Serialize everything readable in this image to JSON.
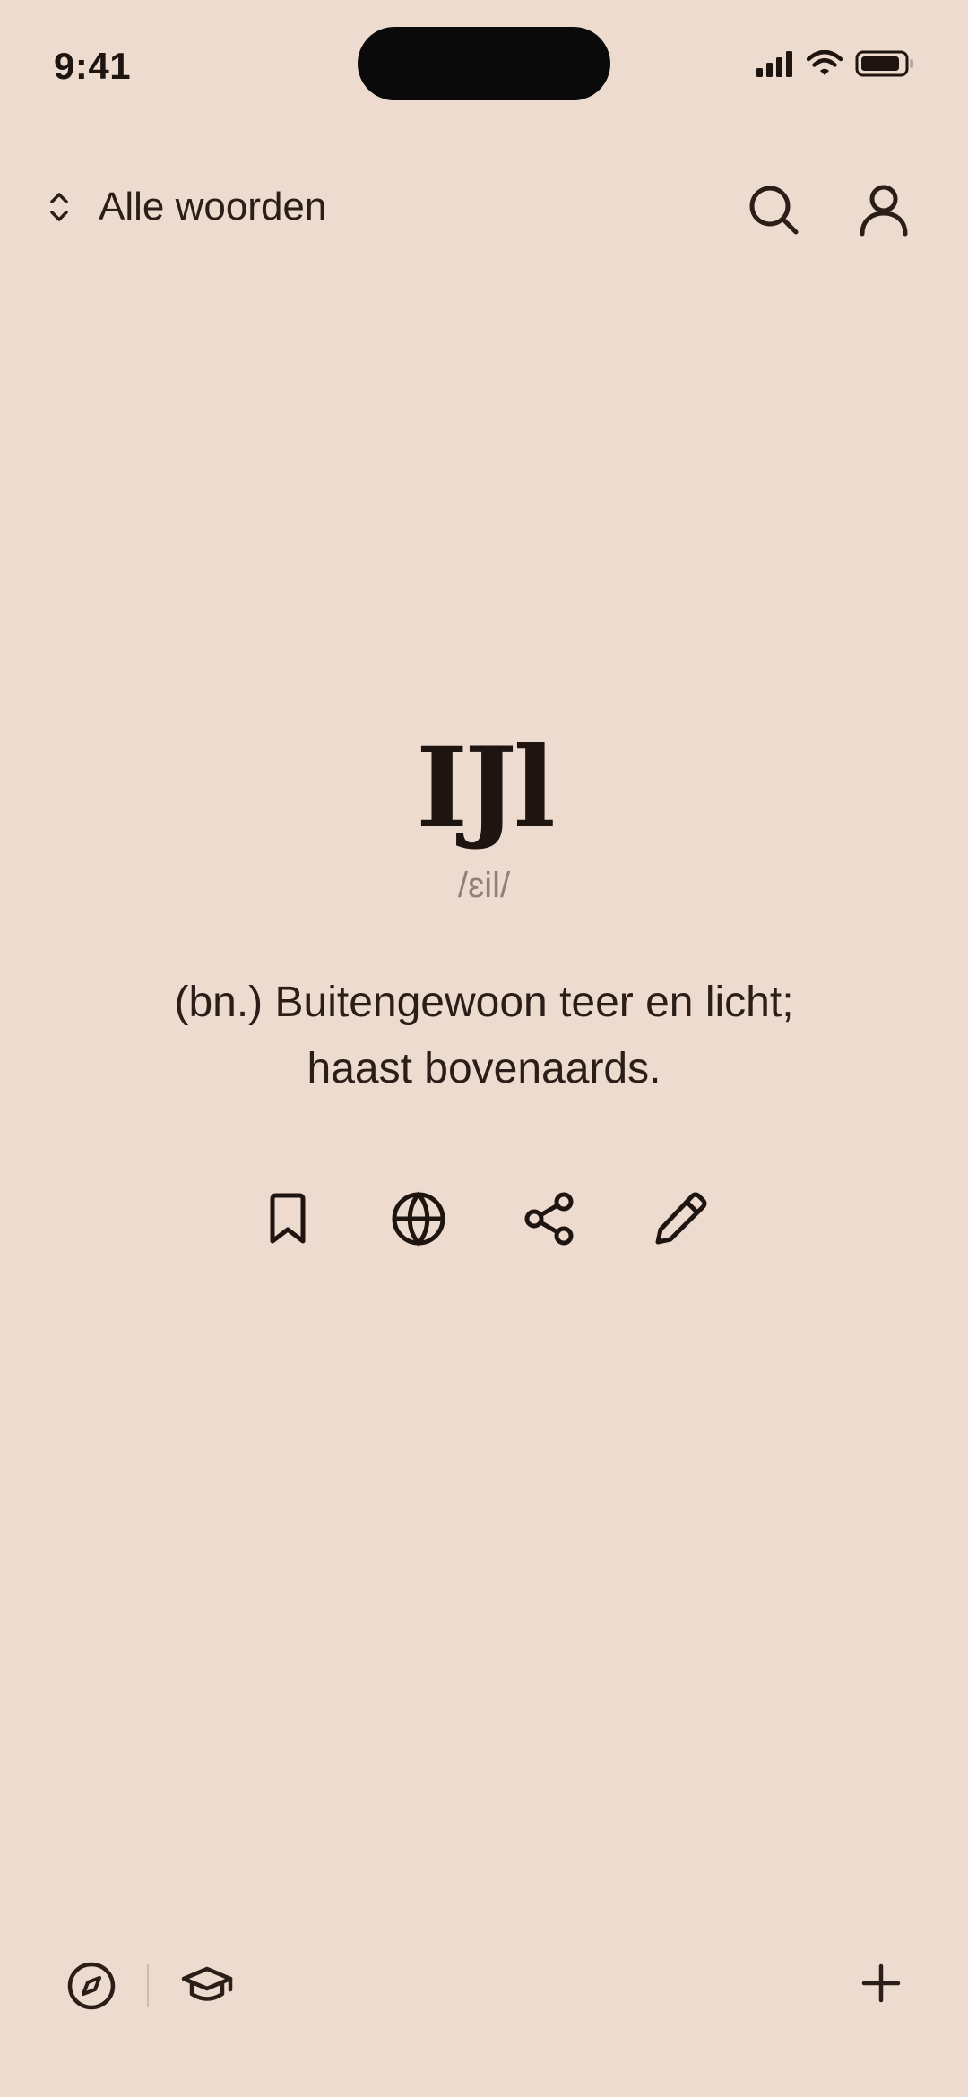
{
  "status_bar": {
    "time": "9:41"
  },
  "header": {
    "filter_label": "Alle woorden",
    "icons": [
      "chevron-updown-icon",
      "search-icon",
      "profile-icon"
    ]
  },
  "word_card": {
    "word": "IJl",
    "phonetic": "/ɛil/",
    "definition": "(bn.) Buitengewoon teer en licht; haast bovenaards."
  },
  "actions": {
    "icons": [
      "bookmark-icon",
      "globe-icon",
      "share-icon",
      "edit-icon"
    ]
  },
  "bottom_bar": {
    "icons": [
      "compass-icon",
      "graduation-cap-icon",
      "plus-icon"
    ]
  },
  "colors": {
    "background": "#EDDBCF",
    "text": "#2B1E18",
    "muted": "#8F8078"
  }
}
